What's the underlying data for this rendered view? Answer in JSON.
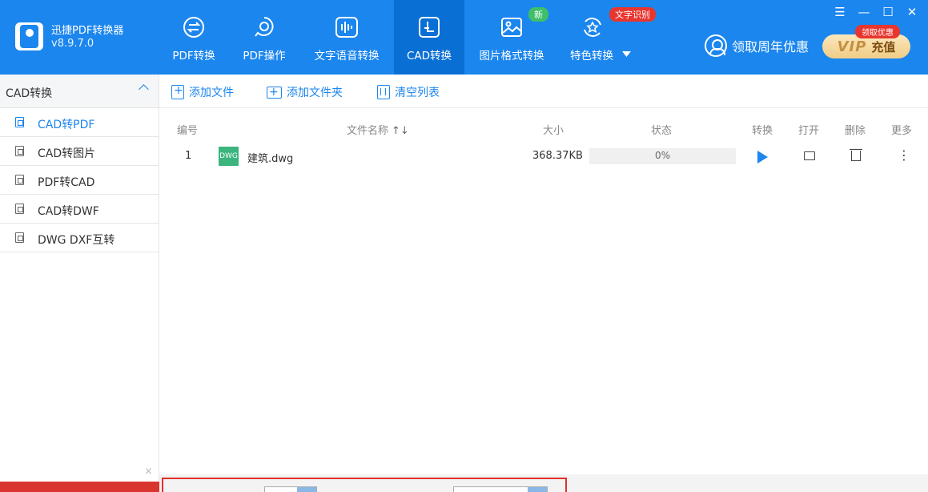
{
  "app": {
    "name": "迅捷PDF转换器",
    "version": "v8.9.7.0"
  },
  "nav": {
    "tabs": [
      {
        "label": "PDF转换",
        "icon": "swap-doc-icon"
      },
      {
        "label": "PDF操作",
        "icon": "gear-doc-icon"
      },
      {
        "label": "文字语音转换",
        "icon": "audio-wave-icon"
      },
      {
        "label": "CAD转换",
        "icon": "cad-icon",
        "active": true
      },
      {
        "label": "图片格式转换",
        "icon": "image-icon",
        "badge": "新"
      },
      {
        "label": "特色转换",
        "icon": "star-refresh-icon",
        "badge": "文字识别",
        "has_dropdown": true
      }
    ]
  },
  "promo": {
    "label": "领取周年优惠"
  },
  "vip": {
    "badge": "领取优惠",
    "brand": "VIP",
    "label": "充值"
  },
  "colors": {
    "primary": "#1b86ee",
    "active_tab": "#0a6fd5",
    "badge_new": "#3fbf6a",
    "badge_ocr": "#e8362f",
    "vip_gold": "#f1cd86"
  },
  "sidebar": {
    "title": "CAD转换",
    "items": [
      {
        "label": "CAD转PDF",
        "active": true
      },
      {
        "label": "CAD转图片"
      },
      {
        "label": "PDF转CAD"
      },
      {
        "label": "CAD转DWF"
      },
      {
        "label": "DWG DXF互转"
      }
    ]
  },
  "toolbar": {
    "add_file": "添加文件",
    "add_folder": "添加文件夹",
    "clear_list": "清空列表"
  },
  "table": {
    "headers": {
      "index": "编号",
      "name": "文件名称",
      "size": "大小",
      "status": "状态",
      "convert": "转换",
      "open": "打开",
      "delete": "删除",
      "more": "更多"
    },
    "rows": [
      {
        "index": "1",
        "file_type": "DWG",
        "name": "建筑.dwg",
        "size": "368.37KB",
        "progress_text": "0%",
        "progress": 0
      }
    ]
  }
}
